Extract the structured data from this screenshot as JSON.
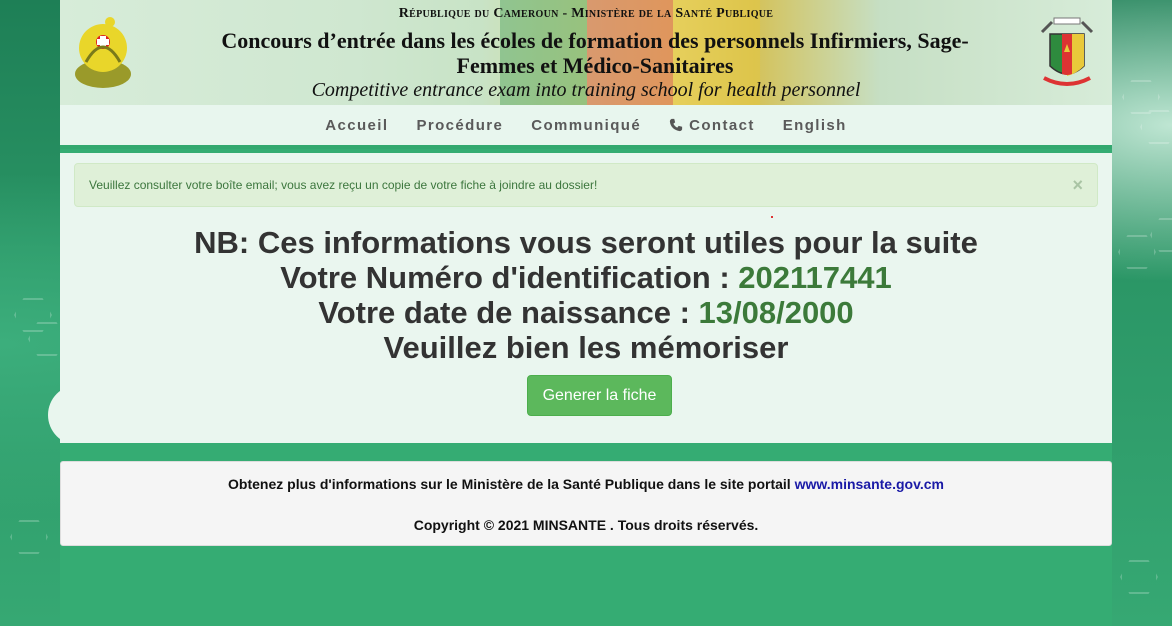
{
  "banner": {
    "line1": "République du Cameroun - Ministère de la Santé Publique",
    "line2": "Concours d’entrée dans les écoles de formation des personnels Infirmiers, Sage-Femmes et Médico-Sanitaires",
    "line3": "Competitive entrance exam into training school for health personnel"
  },
  "nav": {
    "items": [
      {
        "label": "Accueil"
      },
      {
        "label": "Procédure"
      },
      {
        "label": "Communiqué"
      },
      {
        "label": "Contact",
        "icon": "phone-icon"
      },
      {
        "label": "English"
      }
    ]
  },
  "alert": {
    "message": "Veuillez consulter votre boîte email; vous avez reçu un copie de votre fiche à joindre au dossier!",
    "close": "×"
  },
  "info": {
    "line1": "NB: Ces informations vous seront utiles pour la suite",
    "id_label": "Votre Numéro d'identification : ",
    "id_value": "202117441",
    "dob_label": "Votre date de naissance : ",
    "dob_value": "13/08/2000",
    "line4": "Veuillez bien les mémoriser"
  },
  "button": {
    "label": "Generer la fiche"
  },
  "footer": {
    "text": "Obtenez plus d'informations sur le Ministère de la Santé Publique dans le site portail ",
    "link": "www.minsante.gov.cm",
    "copyright": "Copyright © 2021 MINSANTE . Tous droits réservés."
  },
  "colors": {
    "accent_green": "#5cb85c",
    "value_green": "#3c7a3a",
    "alert_bg": "#dff0d8",
    "page_green": "#35ac73"
  }
}
